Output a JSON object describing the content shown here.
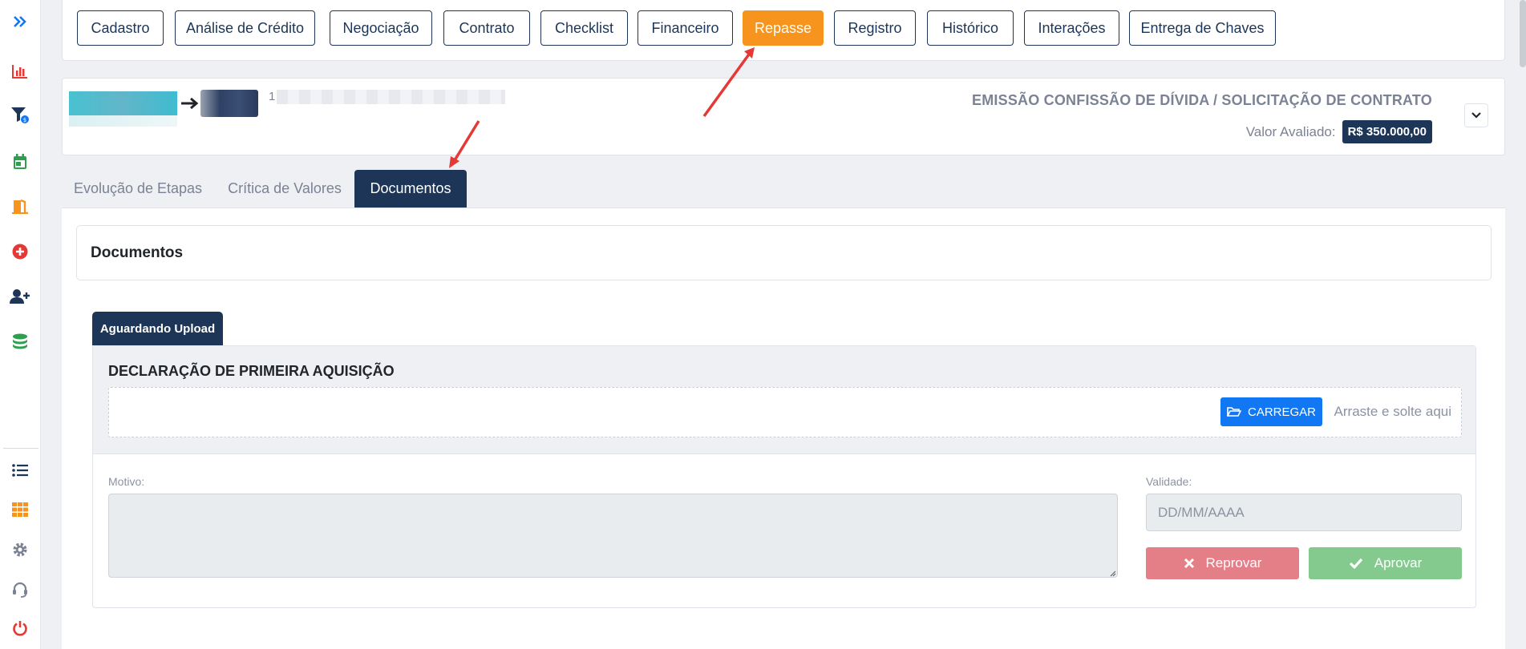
{
  "sidebar": {
    "items": [
      {
        "name": "expand-icon",
        "color": "#1277f2"
      },
      {
        "name": "chart-bar-icon",
        "color": "#e53935"
      },
      {
        "name": "filter-money-icon",
        "color": "#1d3557"
      },
      {
        "name": "calendar-icon",
        "color": "#2e9e4f"
      },
      {
        "name": "door-icon",
        "color": "#f7941d"
      },
      {
        "name": "plus-circle-icon",
        "color": "#e53935"
      },
      {
        "name": "user-plus-icon",
        "color": "#1d3557"
      },
      {
        "name": "coins-icon",
        "color": "#2e9e4f"
      },
      {
        "name": "list-icon",
        "color": "#1d3557"
      },
      {
        "name": "grid-icon",
        "color": "#f7941d"
      },
      {
        "name": "gear-icon",
        "color": "#7b8293"
      },
      {
        "name": "headset-icon",
        "color": "#7b8293"
      },
      {
        "name": "power-icon",
        "color": "#e53935"
      }
    ]
  },
  "steps": [
    {
      "label": "Cadastro",
      "active": false
    },
    {
      "label": "Análise de Crédito",
      "active": false
    },
    {
      "label": "Negociação",
      "active": false
    },
    {
      "label": "Contrato",
      "active": false
    },
    {
      "label": "Checklist",
      "active": false
    },
    {
      "label": "Financeiro",
      "active": false
    },
    {
      "label": "Repasse",
      "active": true
    },
    {
      "label": "Registro",
      "active": false
    },
    {
      "label": "Histórico",
      "active": false
    },
    {
      "label": "Interações",
      "active": false
    },
    {
      "label": "Entrega de Chaves",
      "active": false
    }
  ],
  "card": {
    "title": "EMISSÃO CONFISSÃO DE DÍVIDA / SOLICITAÇÃO DE CONTRATO",
    "valor_label": "Valor Avaliado:",
    "valor": "R$ 350.000,00",
    "id_prefix": "1"
  },
  "tabs": [
    {
      "label": "Evolução de Etapas",
      "active": false
    },
    {
      "label": "Crítica de Valores",
      "active": false
    },
    {
      "label": "Documentos",
      "active": true
    }
  ],
  "documents": {
    "header": "Documentos",
    "status_tab": "Aguardando Upload",
    "doc_name": "DECLARAÇÃO DE PRIMEIRA AQUISIÇÃO",
    "upload_button": "CARREGAR",
    "drop_hint": "Arraste e solte aqui",
    "motivo_label": "Motivo:",
    "validade_label": "Validade:",
    "validade_placeholder": "DD/MM/AAAA",
    "reject_label": "Reprovar",
    "approve_label": "Aprovar"
  },
  "colors": {
    "navy": "#1d3557",
    "orange": "#f7941d",
    "blue": "#1277f2",
    "reject": "#e57f87",
    "approve": "#84c98d"
  }
}
